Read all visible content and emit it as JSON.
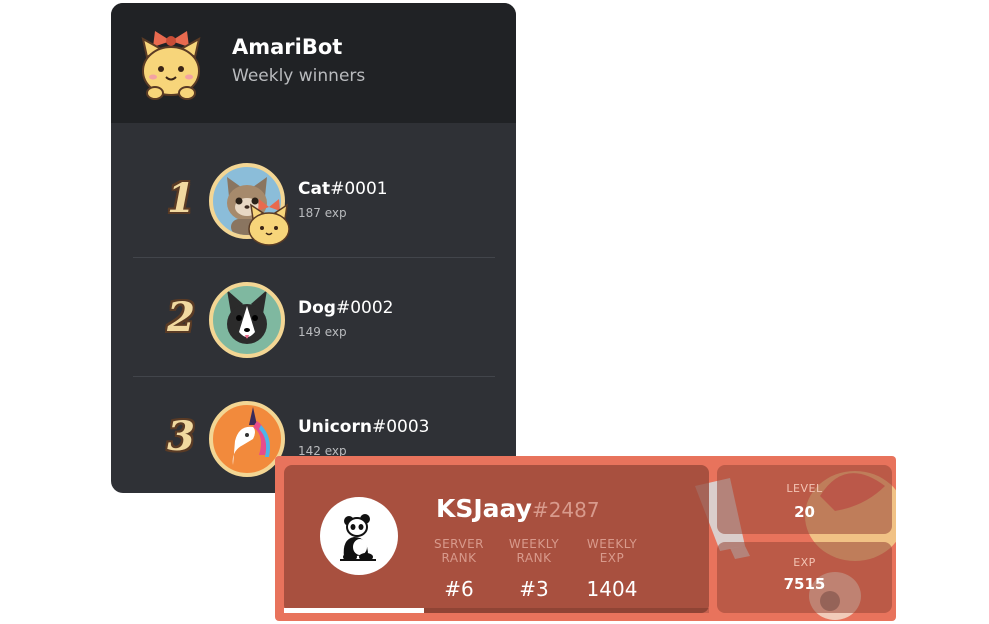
{
  "winners_panel": {
    "bot_name": "AmariBot",
    "subtitle": "Weekly winners",
    "winners": [
      {
        "rank": "1",
        "name": "Cat",
        "discriminator": "#0001",
        "exp": "187 exp",
        "avatar": "cat-avatar"
      },
      {
        "rank": "2",
        "name": "Dog",
        "discriminator": "#0002",
        "exp": "149 exp",
        "avatar": "dog-avatar"
      },
      {
        "rank": "3",
        "name": "Unicorn",
        "discriminator": "#0003",
        "exp": "142 exp",
        "avatar": "unicorn-avatar"
      }
    ]
  },
  "rank_card": {
    "username": "KSJaay",
    "discriminator": "#2487",
    "avatar": "panda-avatar",
    "stats": [
      {
        "label_line1": "SERVER",
        "label_line2": "RANK",
        "value": "#6"
      },
      {
        "label_line1": "WEEKLY",
        "label_line2": "RANK",
        "value": "#3"
      },
      {
        "label_line1": "WEEKLY",
        "label_line2": "EXP",
        "value": "1404"
      }
    ],
    "level_label": "LEVEL",
    "level_value": "20",
    "exp_label": "EXP",
    "exp_value": "7515",
    "progress_fraction": 0.33
  },
  "colors": {
    "panel_bg": "#2f3136",
    "header_bg": "#202225",
    "card_bg": "#e8735c",
    "rank_gold": "#f1d9a0"
  }
}
